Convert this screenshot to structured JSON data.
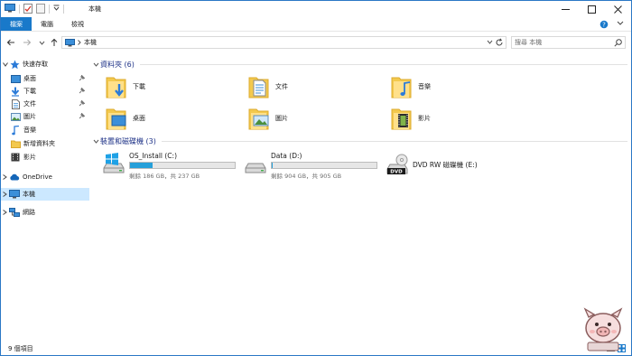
{
  "window": {
    "title": "本機"
  },
  "tabs": [
    {
      "label": "檔案"
    },
    {
      "label": "電腦"
    },
    {
      "label": "檢視"
    }
  ],
  "address": {
    "path": "本機"
  },
  "search": {
    "placeholder": "搜尋 本機"
  },
  "nav": {
    "quick_access": "快速存取",
    "quick_items": [
      {
        "label": "桌面",
        "pinned": true
      },
      {
        "label": "下載",
        "pinned": true
      },
      {
        "label": "文件",
        "pinned": true
      },
      {
        "label": "圖片",
        "pinned": true
      },
      {
        "label": "音樂",
        "pinned": false
      },
      {
        "label": "新增資料夾",
        "pinned": false
      },
      {
        "label": "影片",
        "pinned": false
      }
    ],
    "onedrive": "OneDrive",
    "this_pc": "本機",
    "network": "網路"
  },
  "folders_group": {
    "title": "資料夾 (6)",
    "items": [
      {
        "label": "下載",
        "icon": "downloads-folder-icon"
      },
      {
        "label": "文件",
        "icon": "documents-folder-icon"
      },
      {
        "label": "音樂",
        "icon": "music-folder-icon"
      },
      {
        "label": "桌面",
        "icon": "desktop-folder-icon"
      },
      {
        "label": "圖片",
        "icon": "pictures-folder-icon"
      },
      {
        "label": "影片",
        "icon": "videos-folder-icon"
      }
    ]
  },
  "drives_group": {
    "title": "裝置和磁碟機 (3)",
    "drives": [
      {
        "label": "OS_Install (C:)",
        "free": "剩餘 186 GB，共 237 GB",
        "used_fraction": 0.215,
        "icon": "windows-drive-icon"
      },
      {
        "label": "Data (D:)",
        "free": "剩餘 904 GB，共 905 GB",
        "used_fraction": 0.001,
        "icon": "hard-drive-icon"
      },
      {
        "label": "DVD RW 磁碟機 (E:)",
        "icon": "dvd-drive-icon"
      }
    ]
  },
  "status": {
    "count": "9 個項目"
  },
  "colors": {
    "accent": "#1979ca",
    "group_title": "#1e3287",
    "selection": "#cce8ff",
    "bar_fill": "#26a0da"
  }
}
